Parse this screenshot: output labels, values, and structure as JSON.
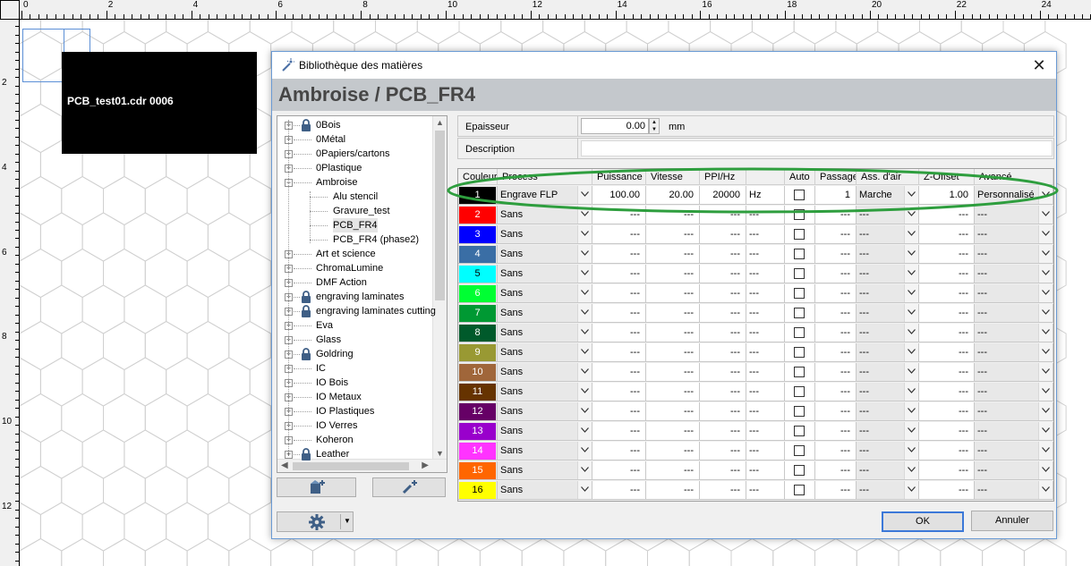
{
  "rulers": {
    "top_numbers": [
      "0",
      "2",
      "4",
      "6",
      "8",
      "10",
      "12",
      "14",
      "16",
      "18",
      "20",
      "22",
      "24"
    ],
    "left_numbers": [
      "2",
      "4",
      "6",
      "8",
      "10",
      "12"
    ]
  },
  "canvas": {
    "object_label": "PCB_test01.cdr 0006"
  },
  "dialog": {
    "title": "Bibliothèque des matières",
    "header": "Ambroise / PCB_FR4",
    "close_glyph": "✕",
    "tree": [
      {
        "label": "0Bois",
        "level": 0,
        "expander": "+",
        "locked": true
      },
      {
        "label": "0Métal",
        "level": 0,
        "expander": "+",
        "locked": false
      },
      {
        "label": "0Papiers/cartons",
        "level": 0,
        "expander": "+",
        "locked": false
      },
      {
        "label": "0Plastique",
        "level": 0,
        "expander": "+",
        "locked": false
      },
      {
        "label": "Ambroise",
        "level": 0,
        "expander": "−",
        "locked": false
      },
      {
        "label": "Alu stencil",
        "level": 1,
        "expander": "",
        "locked": false
      },
      {
        "label": "Gravure_test",
        "level": 1,
        "expander": "",
        "locked": false
      },
      {
        "label": "PCB_FR4",
        "level": 1,
        "expander": "",
        "locked": false,
        "selected": true
      },
      {
        "label": "PCB_FR4 (phase2)",
        "level": 1,
        "expander": "",
        "locked": false
      },
      {
        "label": "Art et science",
        "level": 0,
        "expander": "+",
        "locked": false
      },
      {
        "label": "ChromaLumine",
        "level": 0,
        "expander": "+",
        "locked": false
      },
      {
        "label": "DMF Action",
        "level": 0,
        "expander": "+",
        "locked": false
      },
      {
        "label": "engraving laminates",
        "level": 0,
        "expander": "+",
        "locked": true
      },
      {
        "label": "engraving laminates cutting",
        "level": 0,
        "expander": "+",
        "locked": true
      },
      {
        "label": "Eva",
        "level": 0,
        "expander": "+",
        "locked": false
      },
      {
        "label": "Glass",
        "level": 0,
        "expander": "+",
        "locked": false
      },
      {
        "label": "Goldring",
        "level": 0,
        "expander": "+",
        "locked": true
      },
      {
        "label": "IC",
        "level": 0,
        "expander": "+",
        "locked": false
      },
      {
        "label": "IO Bois",
        "level": 0,
        "expander": "+",
        "locked": false
      },
      {
        "label": "IO Metaux",
        "level": 0,
        "expander": "+",
        "locked": false
      },
      {
        "label": "IO Plastiques",
        "level": 0,
        "expander": "+",
        "locked": false
      },
      {
        "label": "IO Verres",
        "level": 0,
        "expander": "+",
        "locked": false
      },
      {
        "label": "Koheron",
        "level": 0,
        "expander": "+",
        "locked": false
      },
      {
        "label": "Leather",
        "level": 0,
        "expander": "+",
        "locked": true
      }
    ],
    "props": {
      "epaisseur_label": "Epaisseur",
      "epaisseur_value": "0.00",
      "epaisseur_unit": "mm",
      "description_label": "Description",
      "description_value": ""
    },
    "grid": {
      "headers": [
        "Couleur",
        "Process",
        "Puissance",
        "Vitesse",
        "PPI/Hz",
        "",
        "Auto",
        "Passage",
        "Ass. d'air",
        "Z-Offset",
        "Avancé"
      ],
      "rows": [
        {
          "n": "1",
          "color": "#000000",
          "text_color": "#ffffff",
          "process": "Engrave FLP",
          "puissance": "100.00",
          "vitesse": "20.00",
          "ppi": "20000",
          "unit": "Hz",
          "passage": "1",
          "air": "Marche",
          "zoffset": "1.00",
          "avance": "Personnalisé"
        },
        {
          "n": "2",
          "color": "#ff0000",
          "text_color": "#ffffff",
          "process": "Sans",
          "puissance": "---",
          "vitesse": "---",
          "ppi": "---",
          "unit": "---",
          "passage": "---",
          "air": "---",
          "zoffset": "---",
          "avance": "---"
        },
        {
          "n": "3",
          "color": "#0000ff",
          "text_color": "#ffffff",
          "process": "Sans",
          "puissance": "---",
          "vitesse": "---",
          "ppi": "---",
          "unit": "---",
          "passage": "---",
          "air": "---",
          "zoffset": "---",
          "avance": "---"
        },
        {
          "n": "4",
          "color": "#3a6ea5",
          "text_color": "#ffffff",
          "process": "Sans",
          "puissance": "---",
          "vitesse": "---",
          "ppi": "---",
          "unit": "---",
          "passage": "---",
          "air": "---",
          "zoffset": "---",
          "avance": "---"
        },
        {
          "n": "5",
          "color": "#00ffff",
          "text_color": "#000000",
          "process": "Sans",
          "puissance": "---",
          "vitesse": "---",
          "ppi": "---",
          "unit": "---",
          "passage": "---",
          "air": "---",
          "zoffset": "---",
          "avance": "---"
        },
        {
          "n": "6",
          "color": "#00ff33",
          "text_color": "#ffffff",
          "process": "Sans",
          "puissance": "---",
          "vitesse": "---",
          "ppi": "---",
          "unit": "---",
          "passage": "---",
          "air": "---",
          "zoffset": "---",
          "avance": "---"
        },
        {
          "n": "7",
          "color": "#009933",
          "text_color": "#ffffff",
          "process": "Sans",
          "puissance": "---",
          "vitesse": "---",
          "ppi": "---",
          "unit": "---",
          "passage": "---",
          "air": "---",
          "zoffset": "---",
          "avance": "---"
        },
        {
          "n": "8",
          "color": "#005a2b",
          "text_color": "#ffffff",
          "process": "Sans",
          "puissance": "---",
          "vitesse": "---",
          "ppi": "---",
          "unit": "---",
          "passage": "---",
          "air": "---",
          "zoffset": "---",
          "avance": "---"
        },
        {
          "n": "9",
          "color": "#999933",
          "text_color": "#ffffff",
          "process": "Sans",
          "puissance": "---",
          "vitesse": "---",
          "ppi": "---",
          "unit": "---",
          "passage": "---",
          "air": "---",
          "zoffset": "---",
          "avance": "---"
        },
        {
          "n": "10",
          "color": "#a0663a",
          "text_color": "#ffffff",
          "process": "Sans",
          "puissance": "---",
          "vitesse": "---",
          "ppi": "---",
          "unit": "---",
          "passage": "---",
          "air": "---",
          "zoffset": "---",
          "avance": "---"
        },
        {
          "n": "11",
          "color": "#663300",
          "text_color": "#ffffff",
          "process": "Sans",
          "puissance": "---",
          "vitesse": "---",
          "ppi": "---",
          "unit": "---",
          "passage": "---",
          "air": "---",
          "zoffset": "---",
          "avance": "---"
        },
        {
          "n": "12",
          "color": "#660066",
          "text_color": "#ffffff",
          "process": "Sans",
          "puissance": "---",
          "vitesse": "---",
          "ppi": "---",
          "unit": "---",
          "passage": "---",
          "air": "---",
          "zoffset": "---",
          "avance": "---"
        },
        {
          "n": "13",
          "color": "#9900cc",
          "text_color": "#ffffff",
          "process": "Sans",
          "puissance": "---",
          "vitesse": "---",
          "ppi": "---",
          "unit": "---",
          "passage": "---",
          "air": "---",
          "zoffset": "---",
          "avance": "---"
        },
        {
          "n": "14",
          "color": "#ff33ff",
          "text_color": "#ffffff",
          "process": "Sans",
          "puissance": "---",
          "vitesse": "---",
          "ppi": "---",
          "unit": "---",
          "passage": "---",
          "air": "---",
          "zoffset": "---",
          "avance": "---"
        },
        {
          "n": "15",
          "color": "#ff6600",
          "text_color": "#ffffff",
          "process": "Sans",
          "puissance": "---",
          "vitesse": "---",
          "ppi": "---",
          "unit": "---",
          "passage": "---",
          "air": "---",
          "zoffset": "---",
          "avance": "---"
        },
        {
          "n": "16",
          "color": "#ffff00",
          "text_color": "#000000",
          "process": "Sans",
          "puissance": "---",
          "vitesse": "---",
          "ppi": "---",
          "unit": "---",
          "passage": "---",
          "air": "---",
          "zoffset": "---",
          "avance": "---"
        }
      ]
    },
    "buttons": {
      "ok": "OK",
      "cancel": "Annuler"
    },
    "highlight_color": "#2e9e3e"
  }
}
